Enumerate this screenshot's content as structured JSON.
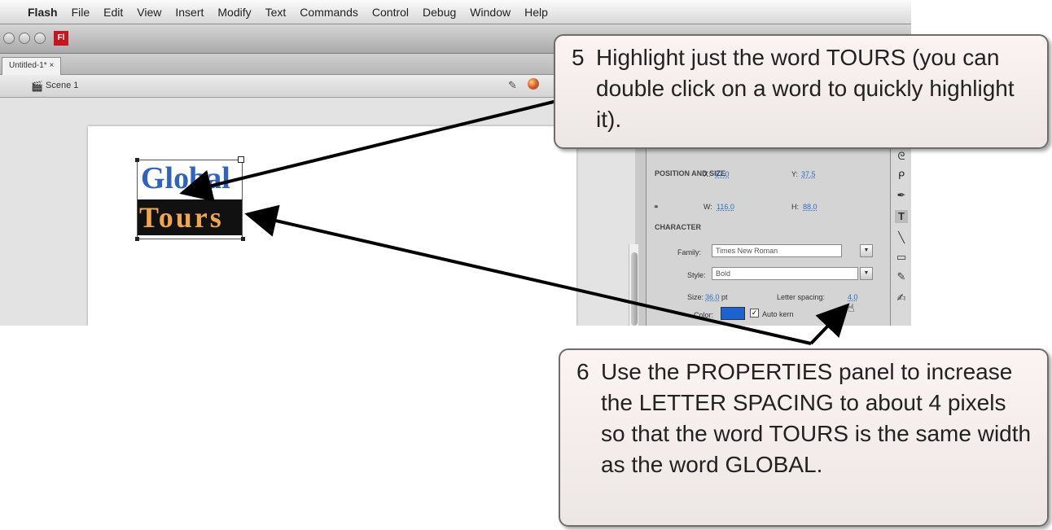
{
  "menubar": {
    "app_name": "Flash",
    "items": [
      "File",
      "Edit",
      "View",
      "Insert",
      "Modify",
      "Text",
      "Commands",
      "Control",
      "Debug",
      "Window",
      "Help"
    ]
  },
  "window": {
    "badge": "Fl",
    "tab_label": "Untitled-1* ×"
  },
  "scene": {
    "label": "Scene 1"
  },
  "stage_text": {
    "line1": "Global",
    "line2": "Tours"
  },
  "properties": {
    "position_section": "POSITION AND SIZE",
    "x_label": "X:",
    "x_value": "57.0",
    "y_label": "Y:",
    "y_value": "37.5",
    "w_label": "W:",
    "w_value": "116.0",
    "h_label": "H:",
    "h_value": "88.0",
    "character_section": "CHARACTER",
    "family_label": "Family:",
    "family_value": "Times New Roman",
    "style_label": "Style:",
    "style_value": "Bold",
    "size_label": "Size:",
    "size_value": "36.0",
    "size_unit": "pt",
    "letter_spacing_label": "Letter spacing:",
    "letter_spacing_value": "4.0",
    "color_label": "Color:",
    "autokern_label": "Auto kern"
  },
  "callouts": {
    "step5": {
      "number": "5",
      "text": "Highlight just the word TOURS (you can double click on a word to quickly highlight it)."
    },
    "step6": {
      "number": "6",
      "text": "Use the PROPERTIES panel to increase the LETTER SPACING to about 4 pixels so that the word TOURS is the same width as the word GLOBAL."
    }
  },
  "colors": {
    "global_text": "#2f63c2",
    "tours_text": "#f1a64a",
    "color_swatch": "#1d62d1",
    "callout_bg": "#f4eeec"
  }
}
